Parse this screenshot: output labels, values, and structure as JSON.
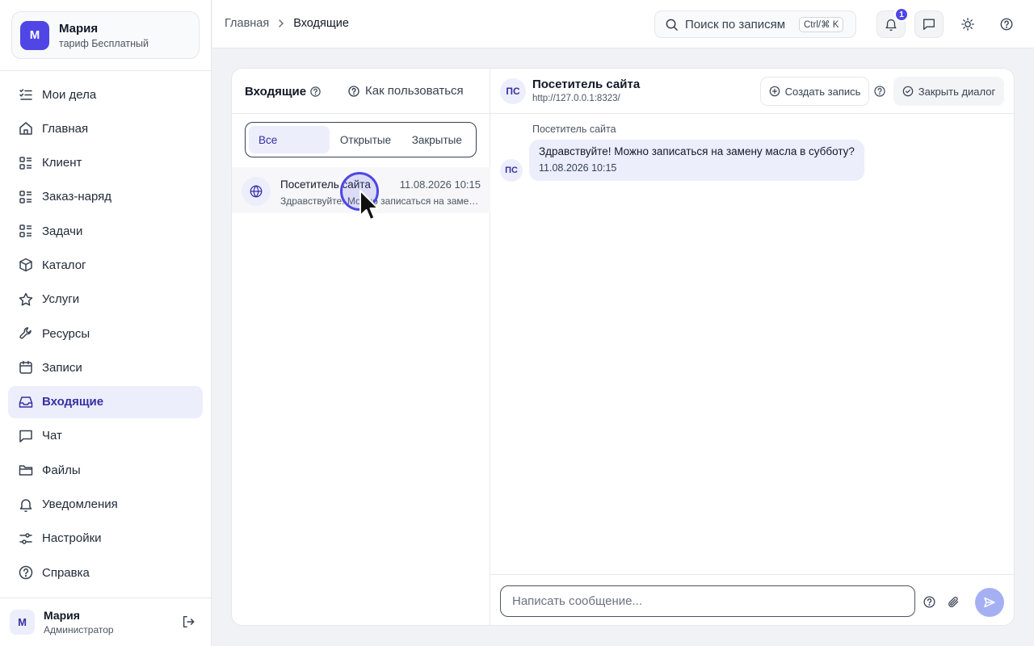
{
  "org": {
    "initial": "М",
    "name": "Мария",
    "plan": "тариф Бесплатный"
  },
  "sidebar": {
    "items": [
      {
        "label": "Мои дела",
        "icon": "checklist-icon",
        "active": false
      },
      {
        "label": "Главная",
        "icon": "home-icon",
        "active": false
      },
      {
        "label": "Клиент",
        "icon": "list-icon",
        "active": false
      },
      {
        "label": "Заказ-наряд",
        "icon": "list-icon",
        "active": false
      },
      {
        "label": "Задачи",
        "icon": "list-icon",
        "active": false
      },
      {
        "label": "Каталог",
        "icon": "box-icon",
        "active": false
      },
      {
        "label": "Услуги",
        "icon": "star-icon",
        "active": false
      },
      {
        "label": "Ресурсы",
        "icon": "wrench-icon",
        "active": false
      },
      {
        "label": "Записи",
        "icon": "calendar-icon",
        "active": false
      },
      {
        "label": "Входящие",
        "icon": "inbox-icon",
        "active": true
      },
      {
        "label": "Чат",
        "icon": "chat-icon",
        "active": false
      },
      {
        "label": "Файлы",
        "icon": "folder-icon",
        "active": false
      },
      {
        "label": "Уведомления",
        "icon": "bell-icon",
        "active": false
      },
      {
        "label": "Настройки",
        "icon": "sliders-icon",
        "active": false
      },
      {
        "label": "Справка",
        "icon": "help-icon",
        "active": false
      }
    ]
  },
  "user": {
    "initial": "М",
    "name": "Мария",
    "role": "Администратор"
  },
  "breadcrumb": {
    "home": "Главная",
    "current": "Входящие"
  },
  "search": {
    "placeholder": "Поиск по записям",
    "shortcut": "Ctrl/⌘ K"
  },
  "notifications": {
    "count": "1"
  },
  "inbox": {
    "title": "Входящие",
    "howto": "Как пользоваться",
    "filters": [
      "Все",
      "Открытые",
      "Закрытые"
    ],
    "active_filter": 0,
    "conversations": [
      {
        "name": "Посетитель сайта",
        "time": "11.08.2026 10:15",
        "preview": "Здравствуйте! Можно записаться на замену масла в субботу?"
      }
    ]
  },
  "chat": {
    "initials": "ПС",
    "name": "Посетитель сайта",
    "url": "http://127.0.0.1:8323/",
    "create_label": "Создать запись",
    "close_label": "Закрыть диалог",
    "messages": [
      {
        "sender": "Посетитель сайта",
        "initials": "ПС",
        "text": "Здравствуйте! Можно записаться на замену масла в субботу?",
        "time": "11.08.2026 10:15"
      }
    ],
    "input_placeholder": "Написать сообщение..."
  },
  "colors": {
    "accent": "#4f46e5",
    "accent_soft": "#eceefc",
    "send_disabled": "#a5b0f3"
  }
}
